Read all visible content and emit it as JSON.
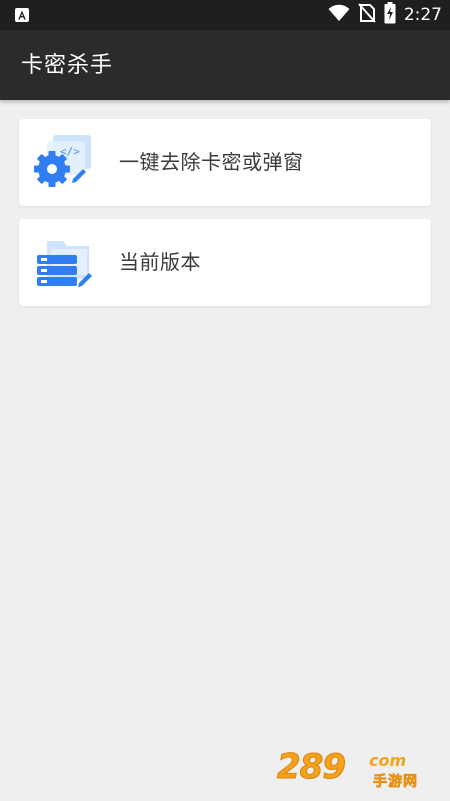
{
  "status_bar": {
    "time": "2:27",
    "left_icon": "android-a-icon",
    "icons": [
      "wifi-icon",
      "no-sim-icon",
      "battery-charging-icon"
    ]
  },
  "app_bar": {
    "title": "卡密杀手"
  },
  "cards": [
    {
      "label": "一键去除卡密或弹窗",
      "icon": "code-gear-icon"
    },
    {
      "label": "当前版本",
      "icon": "server-folder-icon"
    }
  ],
  "watermark": {
    "digits": "289",
    "suffix": "com",
    "cn": "手游网"
  },
  "colors": {
    "status_bg": "#1f1f1f",
    "app_bar_bg": "#2b2b2b",
    "page_bg": "#efefef",
    "card_bg": "#ffffff",
    "icon_blue": "#2f7ef2",
    "watermark_orange": "#f4a21a"
  }
}
